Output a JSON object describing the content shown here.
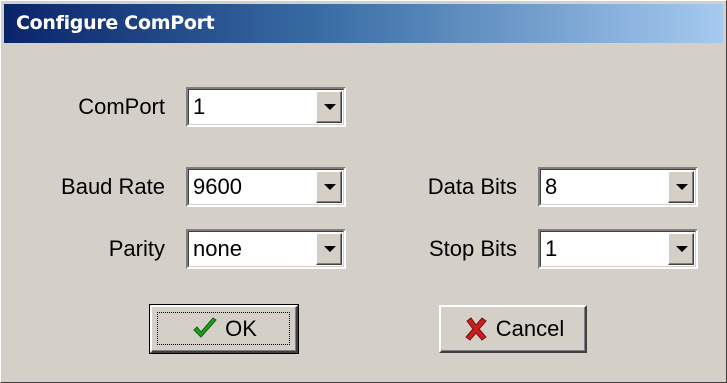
{
  "window": {
    "title": "Configure ComPort"
  },
  "fields": {
    "comport": {
      "label": "ComPort",
      "value": "1"
    },
    "baud_rate": {
      "label": "Baud Rate",
      "value": "9600"
    },
    "parity": {
      "label": "Parity",
      "value": "none"
    },
    "data_bits": {
      "label": "Data Bits",
      "value": "8"
    },
    "stop_bits": {
      "label": "Stop Bits",
      "value": "1"
    }
  },
  "buttons": {
    "ok": {
      "label": "OK",
      "icon": "checkmark-icon",
      "color": "#1e9e1e"
    },
    "cancel": {
      "label": "Cancel",
      "icon": "x-icon",
      "color": "#c81e1e"
    }
  }
}
